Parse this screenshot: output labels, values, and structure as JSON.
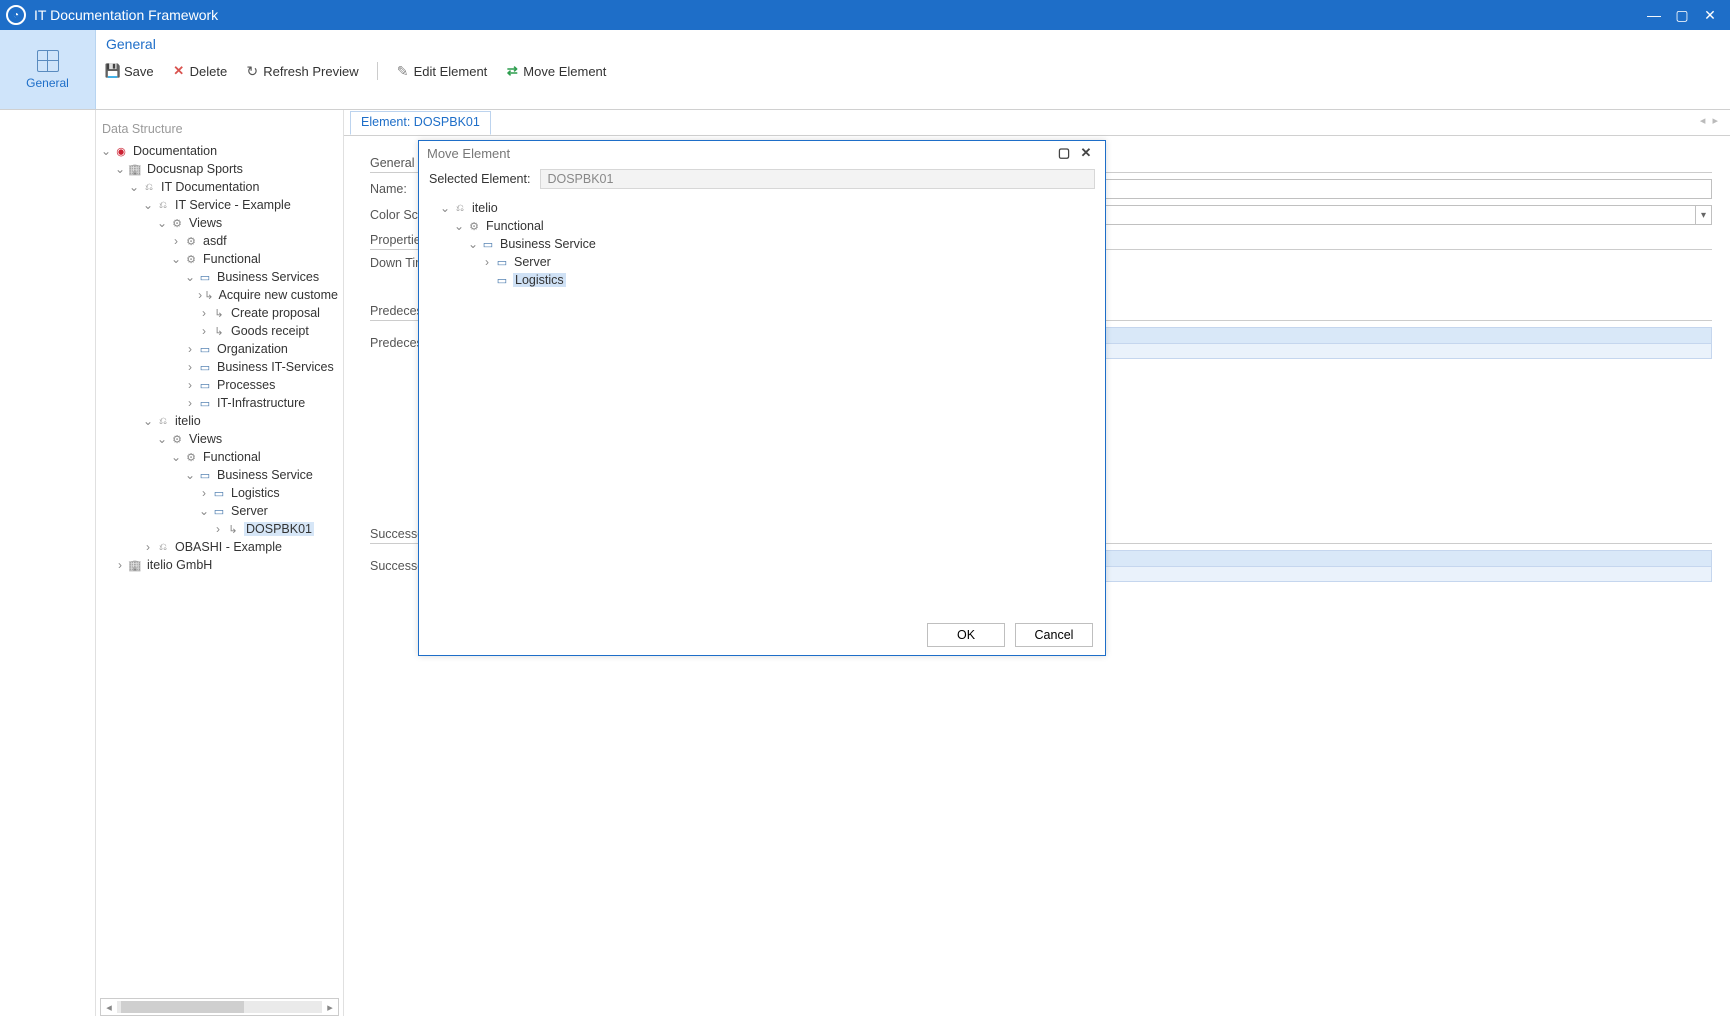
{
  "app": {
    "title": "IT Documentation Framework"
  },
  "ribbon": {
    "side_label": "General",
    "title": "General",
    "buttons": {
      "save": "Save",
      "delete": "Delete",
      "refresh": "Refresh Preview",
      "edit": "Edit Element",
      "move": "Move Element"
    }
  },
  "tree": {
    "title": "Data Structure",
    "nodes": {
      "documentation": "Documentation",
      "docusnap_sports": "Docusnap Sports",
      "it_documentation": "IT Documentation",
      "it_service_example": "IT Service - Example",
      "views1": "Views",
      "asdf": "asdf",
      "functional1": "Functional",
      "business_services": "Business Services",
      "acquire": "Acquire new custome",
      "create_proposal": "Create proposal",
      "goods_receipt": "Goods receipt",
      "organization": "Organization",
      "business_it_services": "Business IT-Services",
      "processes": "Processes",
      "it_infrastructure": "IT-Infrastructure",
      "itelio": "itelio",
      "views2": "Views",
      "functional2": "Functional",
      "business_service": "Business Service",
      "logistics": "Logistics",
      "server": "Server",
      "dospbk01": "DOSPBK01",
      "obashi": "OBASHI - Example",
      "itelio_gmbh": "itelio GmbH"
    }
  },
  "editor": {
    "tab": "Element: DOSPBK01",
    "sections": {
      "general": "General",
      "properties": "Properties",
      "predecessors": "Predecessors",
      "successors": "Successors"
    },
    "labels": {
      "name": "Name:",
      "color_scheme_short": "Color Sch",
      "down_time_short": "Down Tim",
      "predecessors_short": "Predecess",
      "successors_short": "Successo"
    }
  },
  "dialog": {
    "title": "Move Element",
    "selected_label": "Selected Element:",
    "selected_value": "DOSPBK01",
    "nodes": {
      "itelio": "itelio",
      "functional": "Functional",
      "business_service": "Business Service",
      "server": "Server",
      "logistics": "Logistics"
    },
    "ok": "OK",
    "cancel": "Cancel"
  }
}
